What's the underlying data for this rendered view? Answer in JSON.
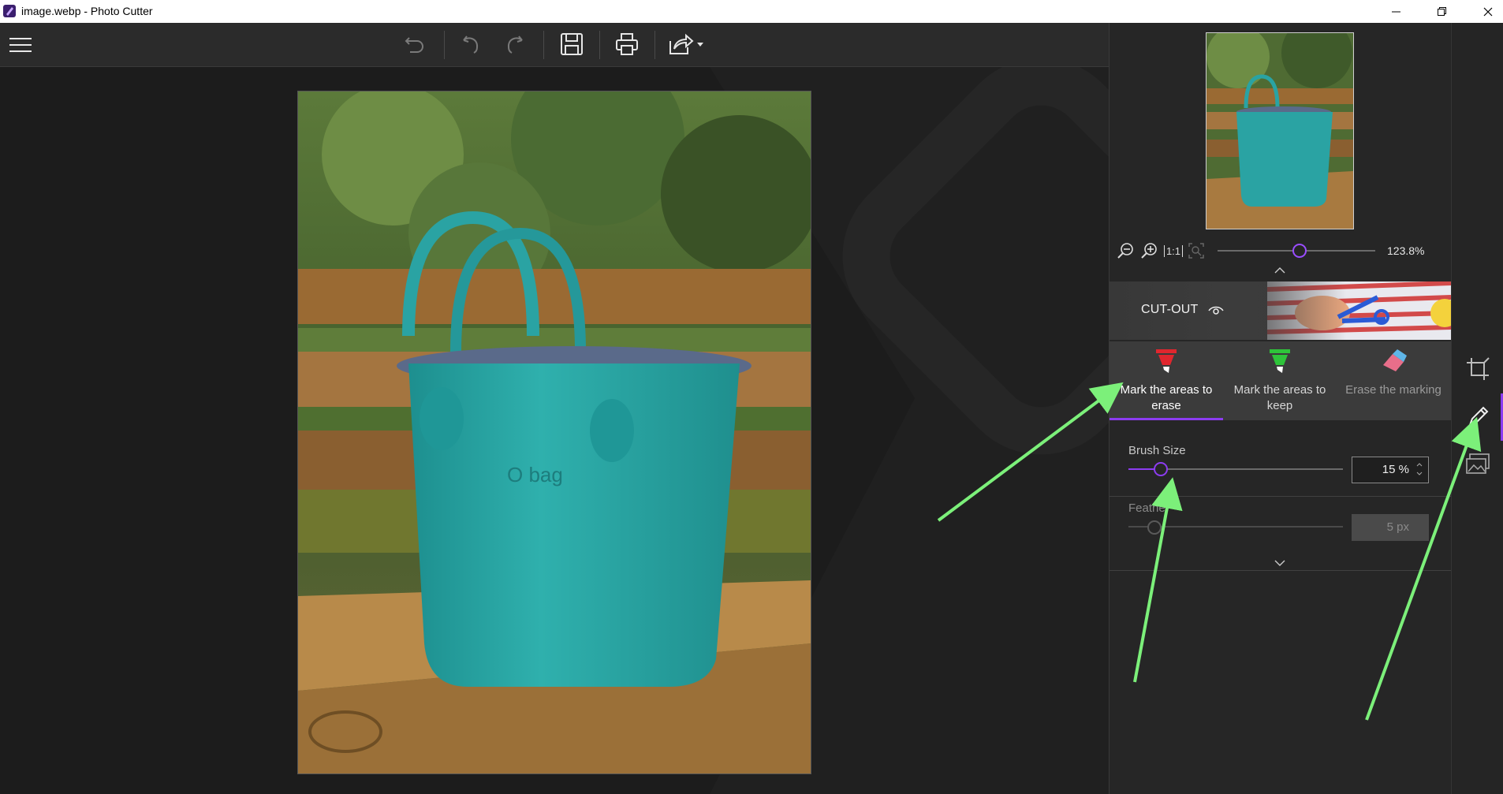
{
  "window": {
    "title": "image.webp - Photo Cutter"
  },
  "toolbar": {
    "icons": [
      "menu-icon",
      "undo-all-icon",
      "undo-icon",
      "redo-icon",
      "save-icon",
      "print-icon",
      "share-icon"
    ]
  },
  "navigator": {
    "zoom_value": "123.8%",
    "zoom_fraction": 0.52,
    "actual_size_label": "1:1"
  },
  "cutout": {
    "label": "CUT-OUT"
  },
  "tools": [
    {
      "label": "Mark the areas to erase",
      "color": "#e0262e",
      "active": true
    },
    {
      "label": "Mark the areas to keep",
      "color": "#2ec43a",
      "active": false
    },
    {
      "label": "Erase the marking",
      "color": "#e86e8a",
      "active": false
    }
  ],
  "brush": {
    "label": "Brush Size",
    "value": "15 %",
    "fraction": 0.15
  },
  "feather": {
    "label": "Feathe",
    "value": "5 px",
    "fraction": 0.12
  },
  "colors": {
    "accent": "#8c3cf0",
    "annotation_arrow": "#7cf07a"
  }
}
